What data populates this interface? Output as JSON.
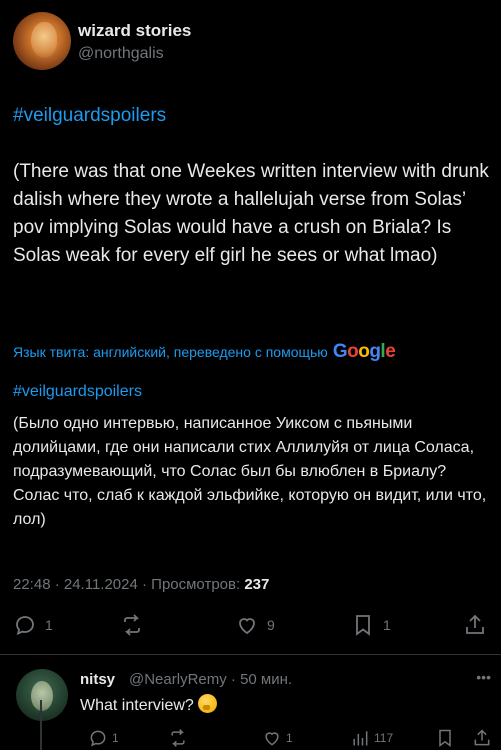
{
  "author": {
    "display_name": "wizard stories",
    "handle": "@northgalis"
  },
  "tweet": {
    "hashtag": "#veilguardspoilers",
    "text": "(There was that one Weekes written interview with drunk dalish where they wrote a hallelujah verse from Solas’ pov implying Solas would have a crush on Briala? Is Solas weak for every elf girl he sees or what lmao)",
    "translation_note": "Язык твита: английский, переведено с помощью",
    "translation_provider": "Google",
    "translated_hashtag": "#veilguardspoilers",
    "translated_text": "(Было одно интервью, написанное Уиксом с пьяными долийцами, где они написали стих Аллилуйя от лица Соласа, подразумевающий, что Солас был бы влюблен в Бриалу? Солас что, слаб к каждой эльфийке, которую он видит, или что, лол)",
    "meta_prefix": "22:48 · 24.11.2024 · Просмотров: ",
    "views": "237"
  },
  "actions": {
    "replies": "1",
    "reposts": "",
    "likes": "9",
    "bookmarks": "1"
  },
  "reply": {
    "display_name": "nitsy",
    "handle_time": "@NearlyRemy · 50 мин.",
    "text": "What interview?",
    "emoji": "thinking-face",
    "replies": "1",
    "reposts": "",
    "likes": "1",
    "views": "117"
  },
  "colors": {
    "background": "#000000",
    "text": "#e7e9ea",
    "muted": "#71767b",
    "accent": "#1d9bf0"
  }
}
